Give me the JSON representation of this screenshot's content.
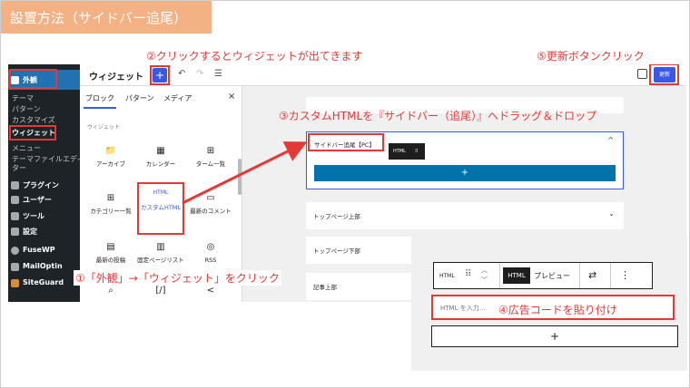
{
  "slide": {
    "title": "設置方法（サイドバー追尾）",
    "annotations": {
      "step1": "①「外観」→「ウィジェット」をクリック",
      "step2": "②クリックするとウィジェットが出てきます",
      "step3": "③カスタムHTMLを『サイドバー（追尾）』へドラッグ＆ドロップ",
      "step4": "④広告コードを貼り付け",
      "step5": "⑤更新ボタンクリック"
    },
    "accent_color": "#e53935",
    "title_band_color": "#f4b183"
  },
  "wp": {
    "sidebar": {
      "active": "外観",
      "items": [
        "テーマ",
        "パターン",
        "カスタマイズ",
        "ウィジェット",
        "メニュー",
        "テーマファイルエディ",
        "ター"
      ],
      "menu": [
        "プラグイン",
        "ユーザー",
        "ツール",
        "設定"
      ],
      "plugins": [
        "FuseWP",
        "MailOptin",
        "SiteGuard"
      ]
    },
    "toolbar": {
      "title": "ウィジェット",
      "plus": "+",
      "undo": "↶",
      "redo": "↷",
      "list": "☰",
      "update": "更新"
    },
    "inserter": {
      "tabs": [
        "ブロック",
        "パターン",
        "メディア"
      ],
      "close": "×",
      "section": "ウィジェット",
      "blocks": [
        {
          "icon": "📁",
          "label": "アーカイブ"
        },
        {
          "icon": "▦",
          "label": "カレンダー"
        },
        {
          "icon": "⊞",
          "label": "ターム一覧"
        },
        {
          "icon": "⊞",
          "label": "カテゴリー一覧"
        },
        {
          "icon": "HTML",
          "label": "カスタムHTML"
        },
        {
          "icon": "▭",
          "label": "最新のコメント"
        },
        {
          "icon": "▤",
          "label": "最新の投稿"
        },
        {
          "icon": "▥",
          "label": "固定ページリスト"
        },
        {
          "icon": "◎",
          "label": "RSS"
        },
        {
          "icon": "⌕",
          "label": ""
        },
        {
          "icon": "[/]",
          "label": ""
        },
        {
          "icon": "<",
          "label": ""
        }
      ]
    },
    "canvas": {
      "open_area": "サイドバー追尾【PC】",
      "drag_chip": "HTML",
      "add": "+",
      "areas": [
        "トップページ上部",
        "トップページ下部",
        "記事上部"
      ],
      "chevron_up": "^",
      "chevron_down": "⌄"
    }
  },
  "inset": {
    "block_label": "HTML",
    "html_button": "HTML",
    "preview_button": "プレビュー",
    "placeholder": "HTML を入力…",
    "more": "⋮",
    "swap": "⇄",
    "add": "+"
  }
}
